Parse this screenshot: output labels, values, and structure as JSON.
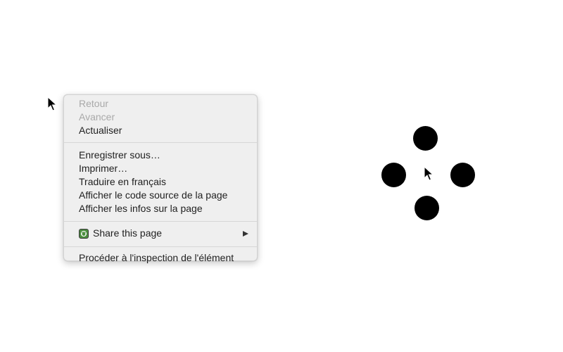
{
  "context_menu": {
    "items": [
      {
        "label": "Retour",
        "enabled": false
      },
      {
        "label": "Avancer",
        "enabled": false
      },
      {
        "label": "Actualiser",
        "enabled": true
      }
    ],
    "items2": [
      {
        "label": "Enregistrer sous…",
        "enabled": true
      },
      {
        "label": "Imprimer…",
        "enabled": true
      },
      {
        "label": "Traduire en français",
        "enabled": true
      },
      {
        "label": "Afficher le code source de la page",
        "enabled": true
      },
      {
        "label": "Afficher les infos sur la page",
        "enabled": true
      }
    ],
    "share": {
      "label": "Share this page",
      "icon": "share-extension-icon",
      "has_submenu": true
    },
    "inspect": {
      "label": "Procéder à l'inspection de l'élément",
      "enabled": true
    }
  },
  "colors": {
    "menu_background": "#efefef",
    "disabled_text": "#a9a9a9",
    "text": "#1f1f1f",
    "dots": "#000000"
  },
  "icons": {
    "cursor": "mouse-pointer-icon",
    "dots": "circle-dot"
  }
}
